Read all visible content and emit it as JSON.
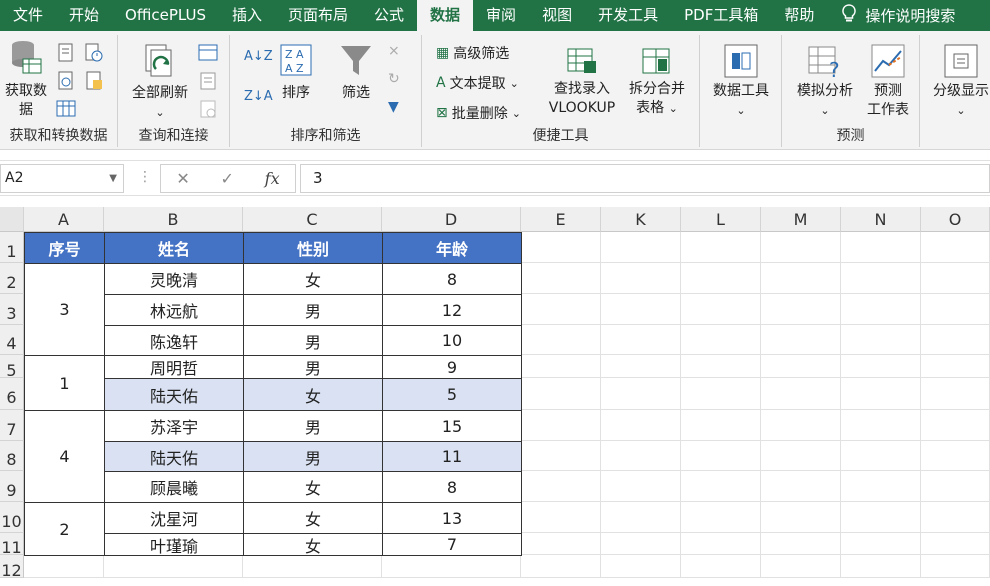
{
  "tabs": [
    "文件",
    "开始",
    "OfficePLUS",
    "插入",
    "页面布局",
    "公式",
    "数据",
    "审阅",
    "视图",
    "开发工具",
    "PDF工具箱",
    "帮助"
  ],
  "active_tab": "数据",
  "tell_me": "操作说明搜索",
  "ribbon": {
    "get_data": {
      "label_line1": "获取数",
      "label_line2": "据",
      "group": "获取和转换数据"
    },
    "refresh": {
      "label": "全部刷新",
      "group": "查询和连接"
    },
    "sort": {
      "label": "排序",
      "group": "排序和筛选"
    },
    "filter": {
      "label": "筛选"
    },
    "quick": {
      "advanced_filter": "高级筛选",
      "text_extract": "文本提取",
      "batch_delete": "批量删除",
      "lookup_line1": "查找录入",
      "lookup_line2": "VLOOKUP",
      "split_line1": "拆分合并",
      "split_line2": "表格",
      "group": "便捷工具"
    },
    "data_tools": {
      "label": "数据工具"
    },
    "whatif": {
      "label": "模拟分析",
      "forecast_line1": "预测",
      "forecast_line2": "工作表",
      "group": "预测"
    },
    "outline": {
      "label": "分级显示"
    }
  },
  "formula_bar": {
    "name_box": "A2",
    "cancel_icon": "✕",
    "enter_icon": "✓",
    "fx": "fx",
    "value": "3"
  },
  "columns": [
    "A",
    "B",
    "C",
    "D",
    "E",
    "K",
    "L",
    "M",
    "N",
    "O"
  ],
  "rows": [
    "1",
    "2",
    "3",
    "4",
    "5",
    "6",
    "7",
    "8",
    "9",
    "10",
    "11",
    "12"
  ],
  "table": {
    "headers": [
      "序号",
      "姓名",
      "性别",
      "年龄"
    ],
    "groups": [
      {
        "seq": "3",
        "people": [
          {
            "name": "灵晚清",
            "gender": "女",
            "age": "8"
          },
          {
            "name": "林远航",
            "gender": "男",
            "age": "12"
          },
          {
            "name": "陈逸轩",
            "gender": "男",
            "age": "10"
          }
        ]
      },
      {
        "seq": "1",
        "people": [
          {
            "name": "周明哲",
            "gender": "男",
            "age": "9"
          },
          {
            "name": "陆天佑",
            "gender": "女",
            "age": "5"
          }
        ]
      },
      {
        "seq": "4",
        "people": [
          {
            "name": "苏泽宇",
            "gender": "男",
            "age": "15"
          },
          {
            "name": "陆天佑",
            "gender": "男",
            "age": "11"
          },
          {
            "name": "顾晨曦",
            "gender": "女",
            "age": "8"
          }
        ]
      },
      {
        "seq": "2",
        "people": [
          {
            "name": "沈星河",
            "gender": "女",
            "age": "13"
          },
          {
            "name": "叶瑾瑜",
            "gender": "女",
            "age": "7"
          }
        ]
      }
    ]
  },
  "colors": {
    "header_fill": "#4472c4",
    "highlight_fill": "#d9e1f2",
    "brand": "#217346"
  }
}
